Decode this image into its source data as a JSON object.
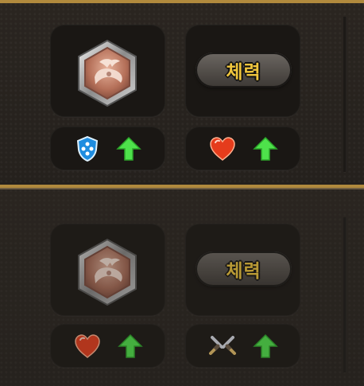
{
  "rows": [
    {
      "badge_label": "체력",
      "left_icon": "blue-shield-icon",
      "right_icon": "heart-icon",
      "up_indicator": "green-up-arrow-icon"
    },
    {
      "badge_label": "체력",
      "left_icon": "heart-icon",
      "right_icon": "crossed-swords-icon",
      "up_indicator": "green-up-arrow-icon"
    }
  ],
  "colors": {
    "gold_border": "#b18a3d",
    "stat_text": "#efc53d",
    "up_arrow": "#4ee24b",
    "shield": "#1f8de0",
    "heart": "#e53c1c"
  }
}
